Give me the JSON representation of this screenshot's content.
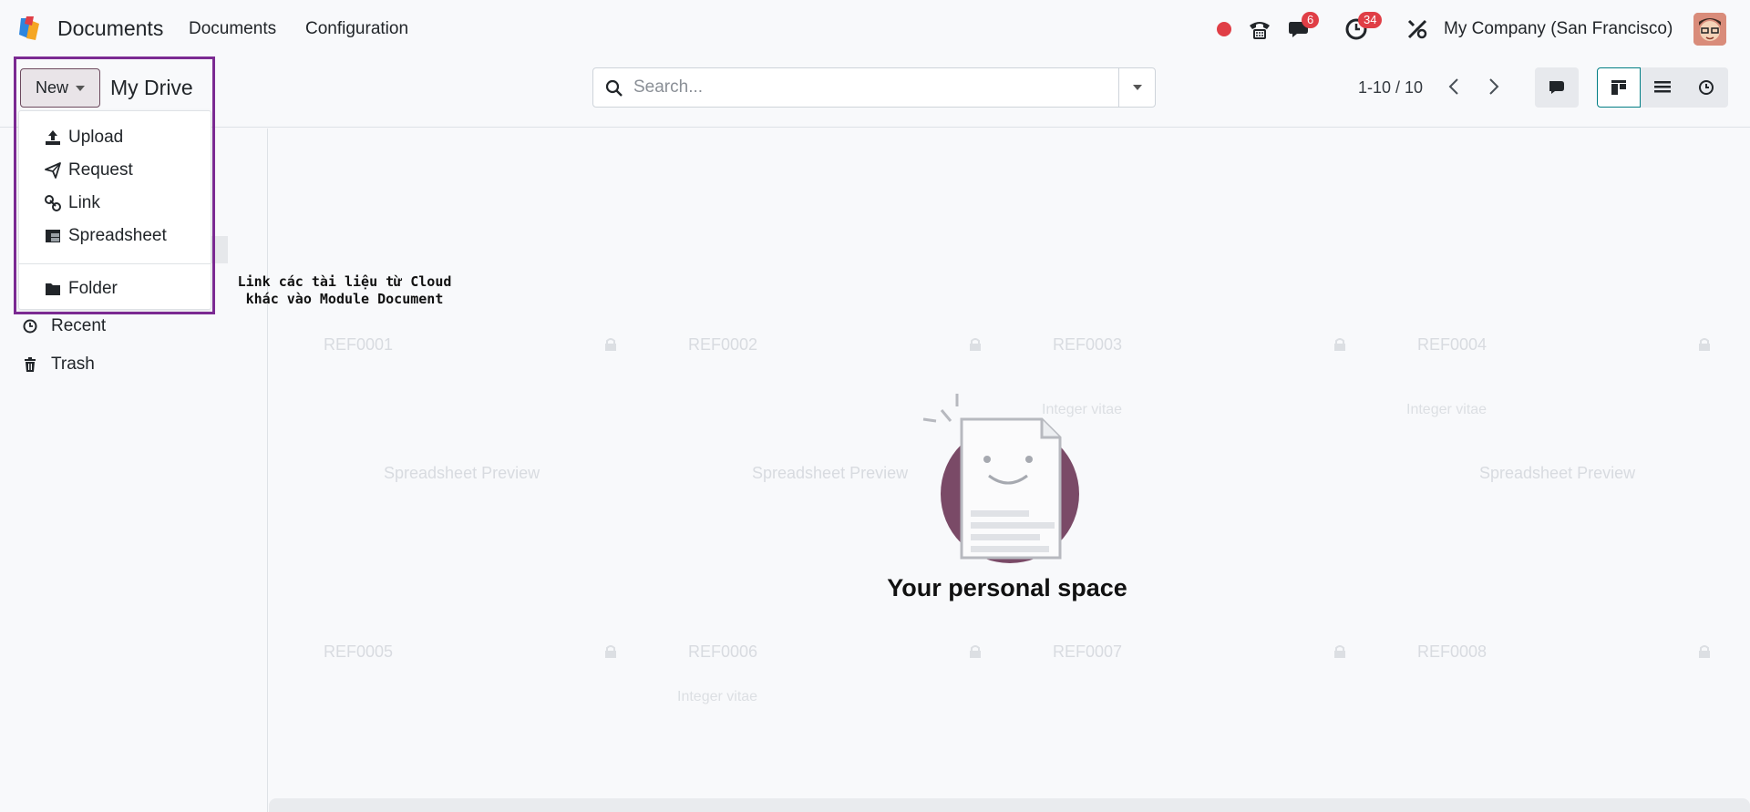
{
  "navbar": {
    "app_name": "Documents",
    "menus": [
      "Documents",
      "Configuration"
    ],
    "messages_count": "6",
    "activities_count": "34",
    "company": "My Company (San Francisco)",
    "status_color": "#e03e46"
  },
  "control": {
    "new_label": "New",
    "breadcrumb": "My Drive",
    "search_placeholder": "Search...",
    "pager": "1-10 / 10"
  },
  "sidebar": {
    "items": [
      {
        "label": "Recent",
        "icon": "clock-icon"
      },
      {
        "label": "Trash",
        "icon": "trash-icon"
      }
    ]
  },
  "dropdown": {
    "items": [
      {
        "label": "Upload",
        "icon": "upload-icon"
      },
      {
        "label": "Request",
        "icon": "paper-plane-icon"
      },
      {
        "label": "Link",
        "icon": "link-icon"
      },
      {
        "label": "Spreadsheet",
        "icon": "spreadsheet-icon"
      },
      {
        "label": "Folder",
        "icon": "folder-icon"
      }
    ]
  },
  "annotation": {
    "line1": "Link các tài liệu từ Cloud",
    "line2": "khác vào Module Document"
  },
  "ghost_cards": {
    "refs": [
      "REF0001",
      "REF0002",
      "REF0003",
      "REF0004",
      "REF0005",
      "REF0006",
      "REF0007",
      "REF0008"
    ],
    "preview_text": "Spreadsheet Preview",
    "subtitle_text": "Integer vitae"
  },
  "empty_state": {
    "title": "Your personal space"
  },
  "colors": {
    "accent": "#7b2a92",
    "primary": "#714b67",
    "teal": "#017e84"
  }
}
